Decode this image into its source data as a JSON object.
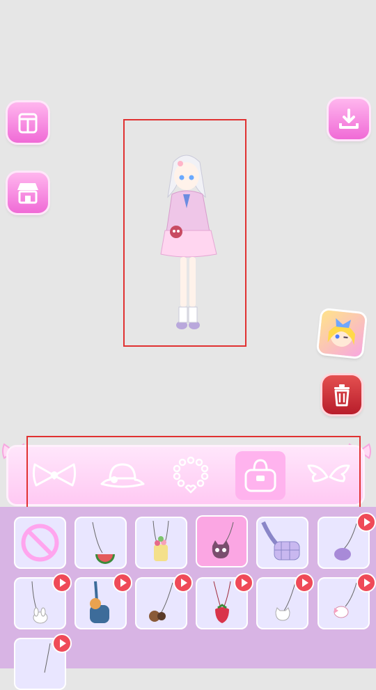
{
  "toolbar": {
    "left": [
      {
        "name": "wardrobe-icon",
        "label": ""
      },
      {
        "name": "shop-icon",
        "label": ""
      }
    ],
    "right": [
      {
        "name": "download-icon"
      },
      {
        "name": "character-avatar-icon"
      },
      {
        "name": "trash-icon"
      }
    ]
  },
  "categories": [
    {
      "name": "bow-icon",
      "active": false
    },
    {
      "name": "hat-icon",
      "active": false
    },
    {
      "name": "necklace-icon",
      "active": false
    },
    {
      "name": "bag-icon",
      "active": true
    },
    {
      "name": "wings-icon",
      "active": false
    }
  ],
  "items": [
    {
      "icon": "none-icon",
      "locked": false,
      "selected": false
    },
    {
      "icon": "watermelon-bag-icon",
      "locked": false,
      "selected": false
    },
    {
      "icon": "flower-basket-bag-icon",
      "locked": false,
      "selected": false
    },
    {
      "icon": "cat-bag-icon",
      "locked": false,
      "selected": true
    },
    {
      "icon": "plaid-waist-bag-icon",
      "locked": false,
      "selected": false
    },
    {
      "icon": "purple-pouch-icon",
      "locked": true,
      "selected": false
    },
    {
      "icon": "bunny-bag-icon",
      "locked": true,
      "selected": false
    },
    {
      "icon": "dog-backpack-icon",
      "locked": true,
      "selected": false
    },
    {
      "icon": "bear-bag-icon",
      "locked": true,
      "selected": false
    },
    {
      "icon": "strawberry-bag-icon",
      "locked": true,
      "selected": false
    },
    {
      "icon": "cat-face-bag-icon",
      "locked": true,
      "selected": false
    },
    {
      "icon": "bow-bunny-bag-icon",
      "locked": true,
      "selected": false
    },
    {
      "icon": "string-bag-icon",
      "locked": true,
      "selected": false
    }
  ],
  "colors": {
    "background": "#e6e6e6",
    "accent": "#f06ad6",
    "panel": "#d8b4e4",
    "highlight_frame": "#e03131",
    "locked_badge": "#ef4a58"
  }
}
